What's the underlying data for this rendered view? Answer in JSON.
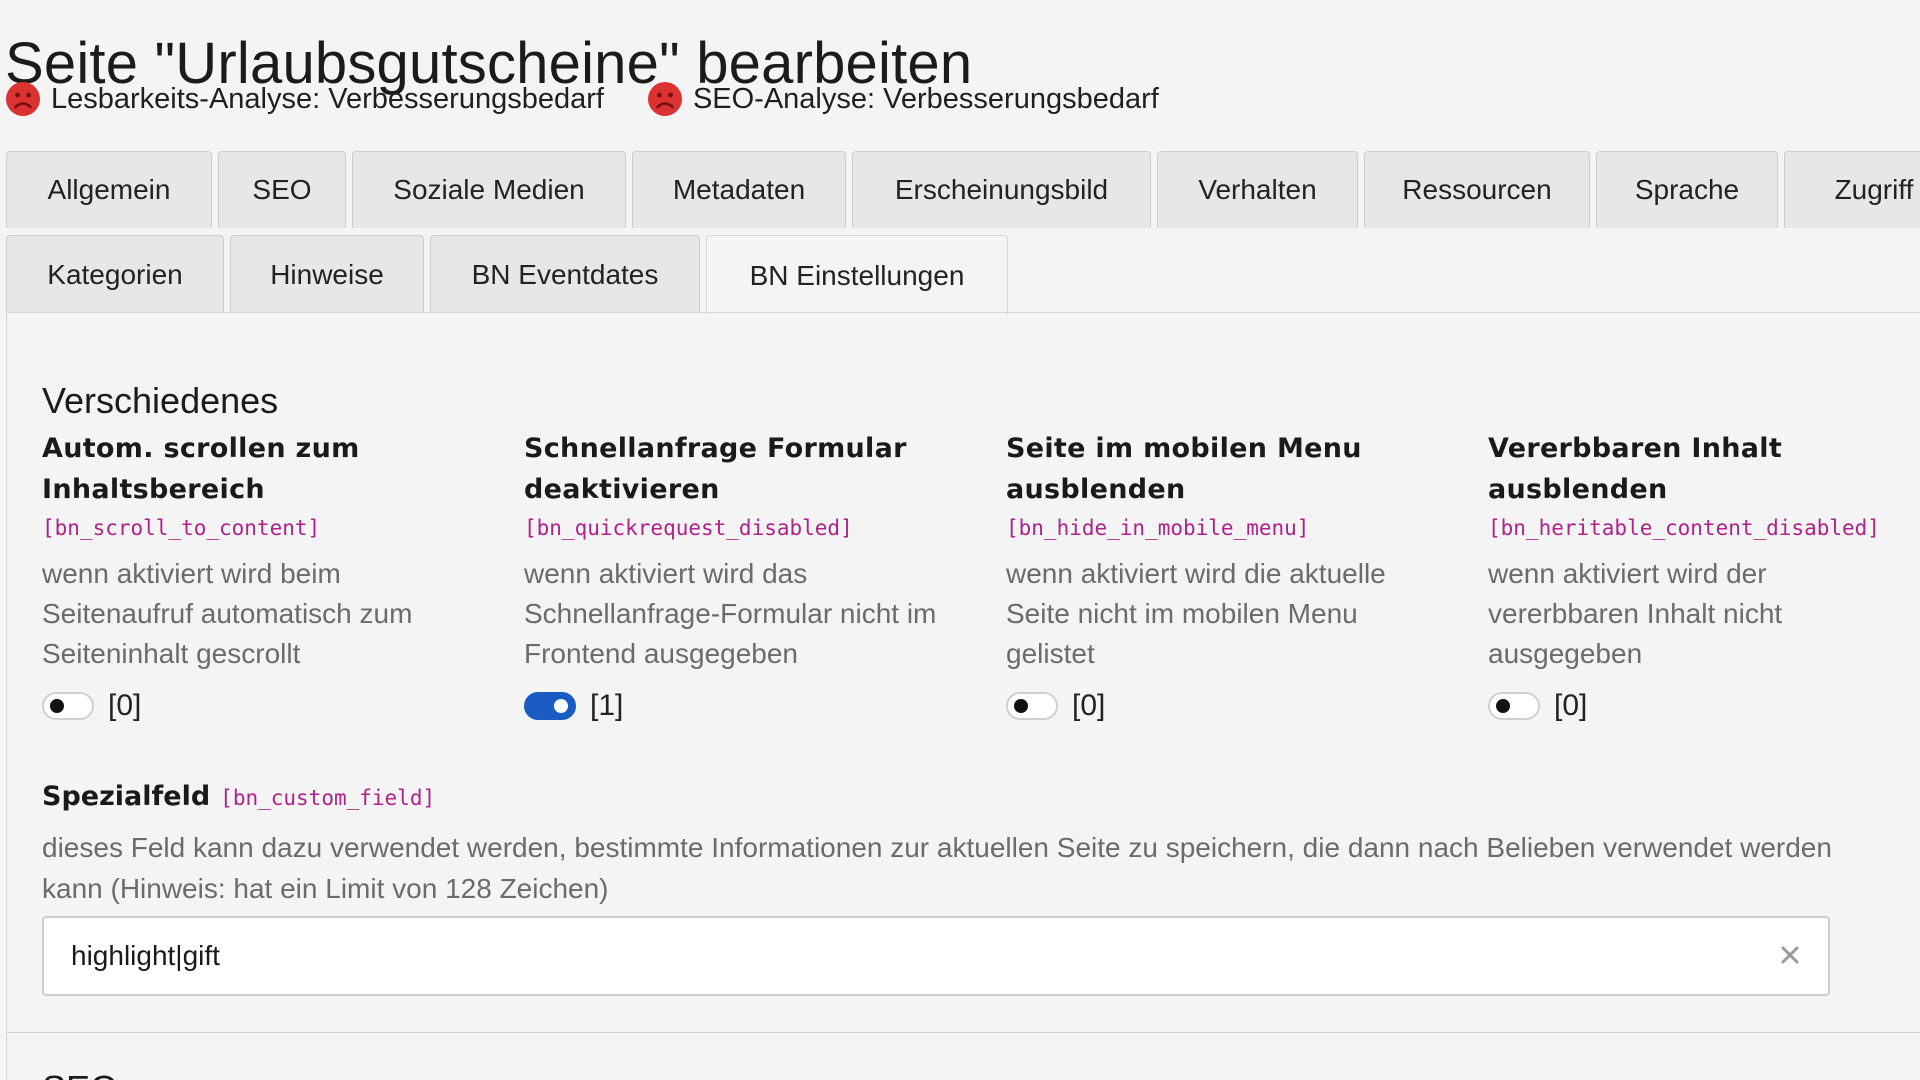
{
  "page": {
    "title": "Seite \"Urlaubsgutscheine\" bearbeiten"
  },
  "analysis": {
    "readability": "Lesbarkeits-Analyse: Verbesserungsbedarf",
    "seo": "SEO-Analyse: Verbesserungsbedarf",
    "status_color": "#dc3232"
  },
  "tabs": {
    "row1": [
      {
        "label": "Allgemein"
      },
      {
        "label": "SEO"
      },
      {
        "label": "Soziale Medien"
      },
      {
        "label": "Metadaten"
      },
      {
        "label": "Erscheinungsbild"
      },
      {
        "label": "Verhalten"
      },
      {
        "label": "Ressourcen"
      },
      {
        "label": "Sprache"
      },
      {
        "label": "Zugriff"
      }
    ],
    "row2": [
      {
        "label": "Kategorien"
      },
      {
        "label": "Hinweise"
      },
      {
        "label": "BN Eventdates"
      },
      {
        "label": "BN Einstellungen",
        "active": true
      }
    ],
    "active_tab": "BN Einstellungen"
  },
  "section": {
    "heading": "Verschiedenes",
    "fields": [
      {
        "label": "Autom. scrollen zum Inhaltsbereich",
        "code": "[bn_scroll_to_content]",
        "description": "wenn aktiviert wird beim Seitenaufruf automatisch zum Seiteninhalt gescrollt",
        "enabled": false,
        "value_text": "[0]"
      },
      {
        "label": "Schnellanfrage Formular deaktivieren",
        "code": "[bn_quickrequest_disabled]",
        "description": "wenn aktiviert wird das Schnellanfrage-Formular nicht im Frontend ausgegeben",
        "enabled": true,
        "value_text": "[1]"
      },
      {
        "label": "Seite im mobilen Menu ausblenden",
        "code": "[bn_hide_in_mobile_menu]",
        "description": "wenn aktiviert wird die aktuelle Seite nicht im mobilen Menu gelistet",
        "enabled": false,
        "value_text": "[0]"
      },
      {
        "label": "Vererbbaren Inhalt ausblenden",
        "code": "[bn_heritable_content_disabled]",
        "description": "wenn aktiviert wird der vererbbaren Inhalt nicht ausgegeben",
        "enabled": false,
        "value_text": "[0]"
      }
    ],
    "toggle_on_color": "#1a5cc1",
    "code_color": "#b0218b"
  },
  "custom_field": {
    "label": "Spezialfeld",
    "code": "[bn_custom_field]",
    "description": "dieses Feld kann dazu verwendet werden, bestimmte Informationen zur aktuellen Seite zu speichern, die dann nach Belieben verwendet werden kann (Hinweis: hat ein Limit von 128 Zeichen)",
    "value": "highlight|gift",
    "clear_icon": "close-icon"
  },
  "next_section": {
    "heading": "SEO"
  }
}
